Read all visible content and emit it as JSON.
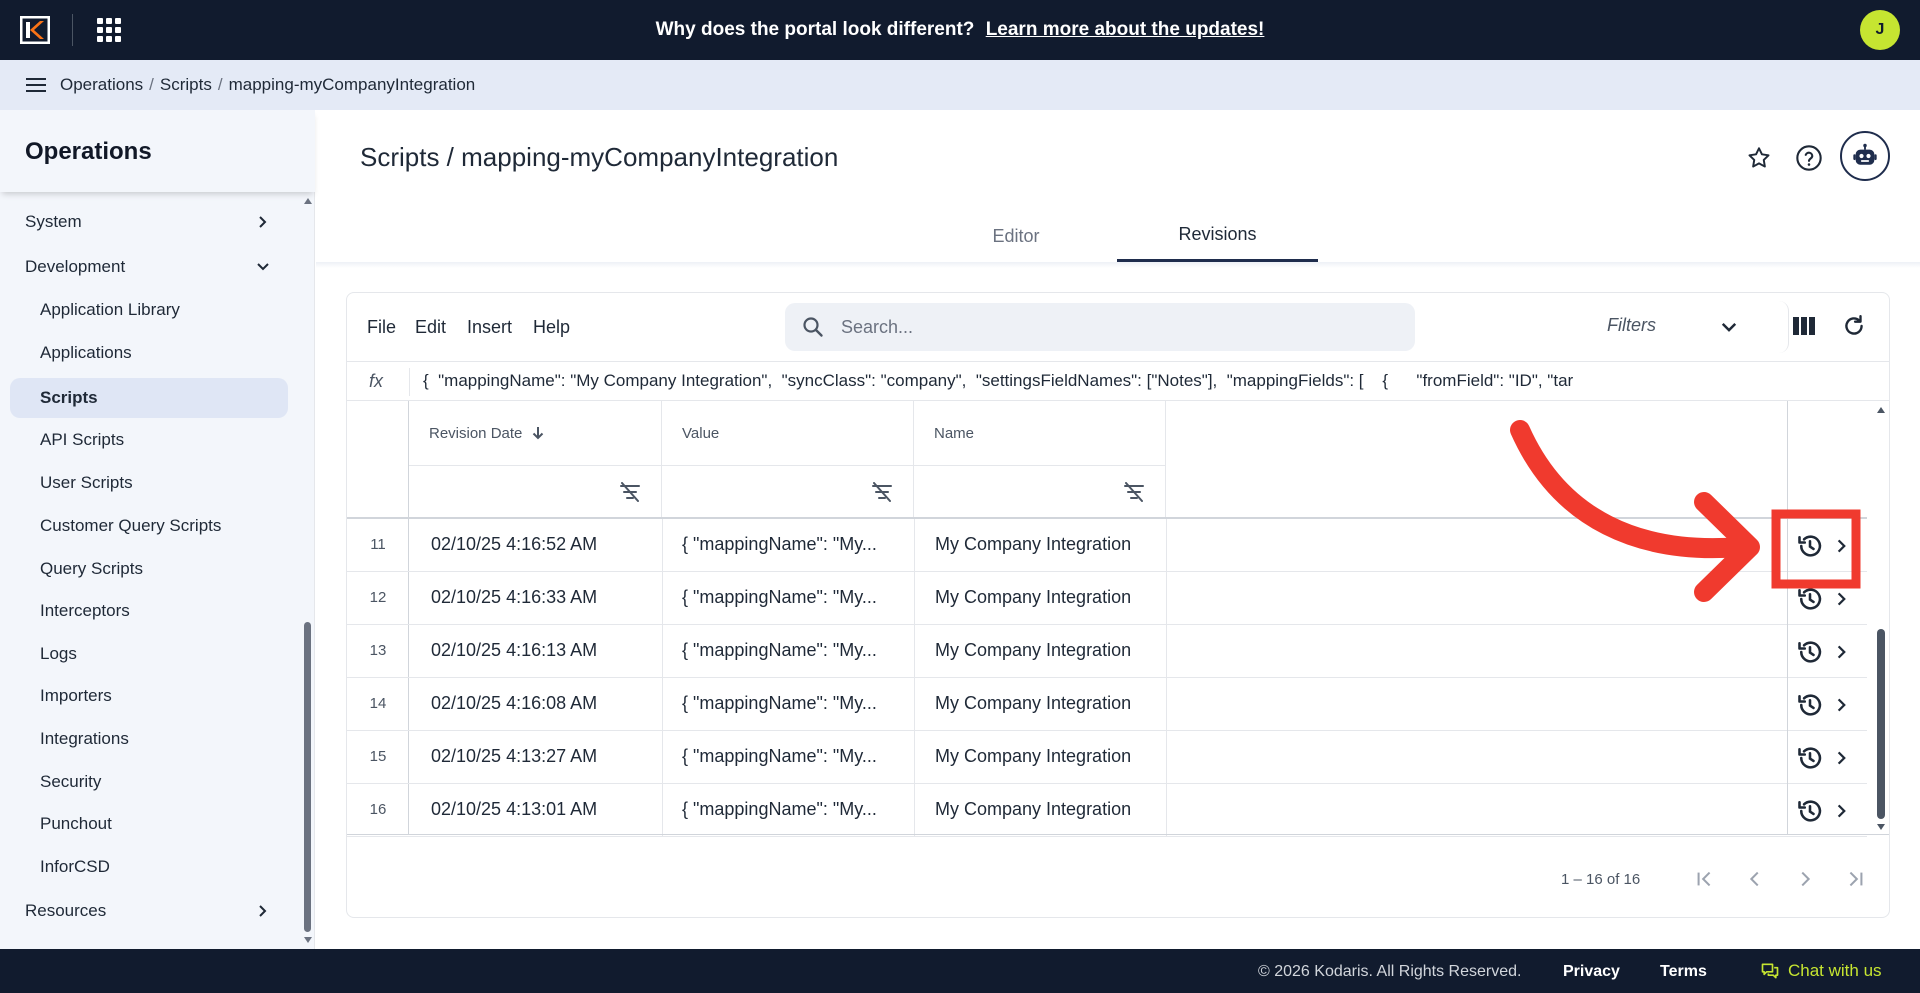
{
  "topbar": {
    "announcement_text": "Why does the portal look different?",
    "announcement_link": "Learn more about the updates!",
    "avatar_initial": "J"
  },
  "breadcrumb": [
    "Operations",
    "Scripts",
    "mapping-myCompanyIntegration"
  ],
  "sidebar": {
    "title": "Operations",
    "items": [
      {
        "label": "System",
        "type": "group",
        "chevron": "right"
      },
      {
        "label": "Development",
        "type": "group",
        "chevron": "down"
      },
      {
        "label": "Application Library",
        "type": "child"
      },
      {
        "label": "Applications",
        "type": "child"
      },
      {
        "label": "Scripts",
        "type": "child",
        "active": true
      },
      {
        "label": "API Scripts",
        "type": "child"
      },
      {
        "label": "User Scripts",
        "type": "child"
      },
      {
        "label": "Customer Query Scripts",
        "type": "child"
      },
      {
        "label": "Query Scripts",
        "type": "child"
      },
      {
        "label": "Interceptors",
        "type": "child"
      },
      {
        "label": "Logs",
        "type": "child"
      },
      {
        "label": "Importers",
        "type": "child"
      },
      {
        "label": "Integrations",
        "type": "child"
      },
      {
        "label": "Security",
        "type": "child"
      },
      {
        "label": "Punchout",
        "type": "child"
      },
      {
        "label": "InforCSD",
        "type": "child"
      },
      {
        "label": "Resources",
        "type": "group",
        "chevron": "right"
      }
    ]
  },
  "page": {
    "title": "Scripts / mapping-myCompanyIntegration",
    "header_icons": [
      "star-icon",
      "help-icon",
      "robot-icon"
    ],
    "tabs": [
      {
        "label": "Editor",
        "active": false
      },
      {
        "label": "Revisions",
        "active": true
      }
    ]
  },
  "grid": {
    "menu": [
      "File",
      "Edit",
      "Insert",
      "Help"
    ],
    "search_placeholder": "Search...",
    "filters_label": "Filters",
    "toolbar_icons": [
      "columns-icon",
      "refresh-icon"
    ],
    "formula_label": "fx",
    "formula_value": "{  \"mappingName\": \"My Company Integration\",  \"syncClass\": \"company\",  \"settingsFieldNames\": [\"Notes\"],  \"mappingFields\": [    {      \"fromField\": \"ID\", \"targetField\": \"erpCompanyId\"",
    "columns": [
      {
        "label": "Revision Date",
        "sort": "desc"
      },
      {
        "label": "Value"
      },
      {
        "label": "Name"
      }
    ],
    "rows": [
      {
        "num": "11",
        "date": "02/10/25 4:16:52 AM",
        "value": "{ \"mappingName\": \"My...",
        "name": "My Company Integration"
      },
      {
        "num": "12",
        "date": "02/10/25 4:16:33 AM",
        "value": "{ \"mappingName\": \"My...",
        "name": "My Company Integration"
      },
      {
        "num": "13",
        "date": "02/10/25 4:16:13 AM",
        "value": "{ \"mappingName\": \"My...",
        "name": "My Company Integration"
      },
      {
        "num": "14",
        "date": "02/10/25 4:16:08 AM",
        "value": "{ \"mappingName\": \"My...",
        "name": "My Company Integration"
      },
      {
        "num": "15",
        "date": "02/10/25 4:13:27 AM",
        "value": "{ \"mappingName\": \"My...",
        "name": "My Company Integration"
      },
      {
        "num": "16",
        "date": "02/10/25 4:13:01 AM",
        "value": "{ \"mappingName\": \"My...",
        "name": "My Company Integration"
      }
    ],
    "pager": {
      "text": "1 – 16 of 16"
    }
  },
  "annotation": {
    "color": "#f03a2e",
    "target": "restore-revision-button row 11"
  },
  "footer": {
    "copyright": "© 2026 Kodaris. All Rights Reserved.",
    "privacy": "Privacy",
    "terms": "Terms",
    "chat": "Chat with us"
  },
  "colors": {
    "topbar_bg": "#111b2e",
    "breadcrumb_bg": "#e4eaf6",
    "sidebar_bg": "#f3f6fb",
    "accent_green": "#c6e531",
    "annotation_red": "#f03a2e"
  }
}
